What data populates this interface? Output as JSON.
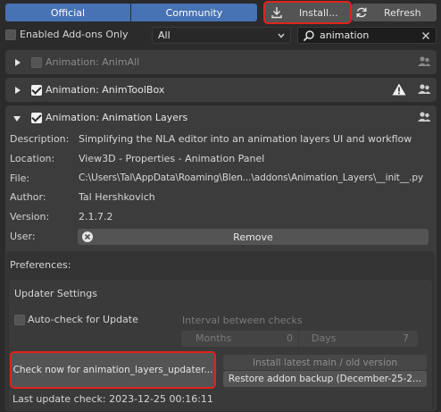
{
  "tabs": {
    "official": "Official",
    "community": "Community"
  },
  "toolbar": {
    "install": "Install...",
    "refresh": "Refresh"
  },
  "filters": {
    "enabled_only": "Enabled Add-ons Only",
    "category": "All",
    "search_value": "animation"
  },
  "addons": [
    {
      "name": "Animation: AnimAll",
      "enabled": false
    },
    {
      "name": "Animation: AnimToolBox",
      "enabled": true,
      "warning": true
    },
    {
      "name": "Animation: Animation Layers",
      "enabled": true,
      "expanded": true
    }
  ],
  "details": {
    "description_label": "Description:",
    "description": "Simplifying the NLA editor into an animation layers UI and workflow",
    "location_label": "Location:",
    "location": "View3D - Properties - Animation Panel",
    "file_label": "File:",
    "file": "C:\\Users\\Tal\\AppData\\Roaming\\Blen...\\addons\\Animation_Layers\\__init__.py",
    "author_label": "Author:",
    "author": "Tal Hershkovich",
    "version_label": "Version:",
    "version": "2.1.7.2",
    "user_label": "User:",
    "remove": "Remove"
  },
  "preferences": {
    "title": "Preferences:",
    "updater_title": "Updater Settings",
    "auto_check": "Auto-check for Update",
    "interval_label": "Interval between checks",
    "months_label": "Months",
    "months_value": "0",
    "days_label": "Days",
    "days_value": "7",
    "check_now": "Check now for animation_layers_updater...",
    "install_latest": "Install latest main / old version",
    "restore_backup": "Restore addon backup (December-25-2...",
    "last_check": "Last update check: 2023-12-25 00:16:11"
  },
  "icons": {
    "install": "download-icon",
    "refresh": "refresh-icon",
    "search": "search-icon",
    "clear": "close-icon",
    "community": "users-icon",
    "warning": "warning-icon",
    "remove": "remove-icon"
  },
  "colors": {
    "accent": "#4772b3",
    "highlight_outline": "#e0231d"
  }
}
